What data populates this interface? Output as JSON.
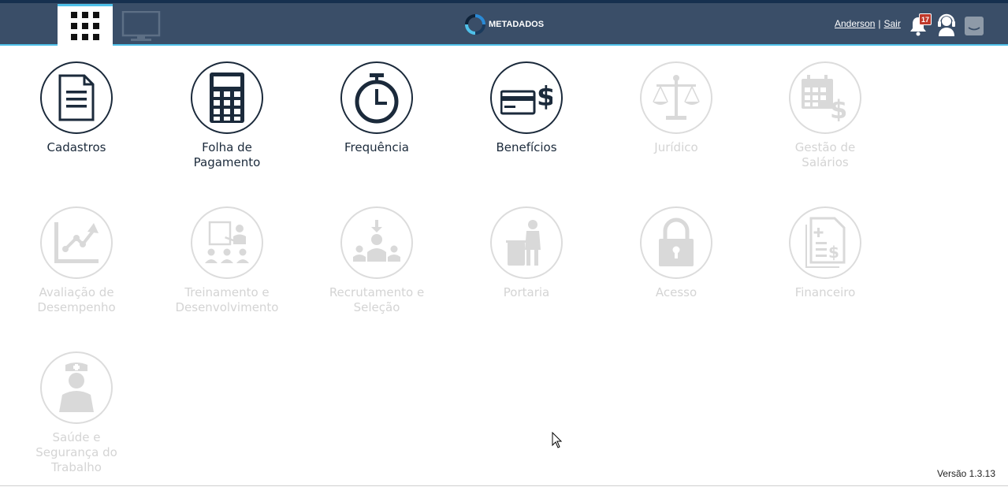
{
  "header": {
    "logo_text": "METADADOS",
    "user_name": "Anderson",
    "separator": "|",
    "logout_label": "Sair",
    "notification_count": "17",
    "colors": {
      "bar": "#3a4e68",
      "accent": "#4fc1ea",
      "badge": "#c0392b"
    }
  },
  "modules": [
    {
      "id": "cadastros",
      "label": "Cadastros",
      "state": "active",
      "icon": "document-icon"
    },
    {
      "id": "folha",
      "label": "Folha de\nPagamento",
      "state": "active",
      "icon": "calculator-icon"
    },
    {
      "id": "frequencia",
      "label": "Frequência",
      "state": "active",
      "icon": "stopwatch-icon"
    },
    {
      "id": "beneficios",
      "label": "Benefícios",
      "state": "active",
      "icon": "card-dollar-icon"
    },
    {
      "id": "juridico",
      "label": "Jurídico",
      "state": "disabled",
      "icon": "scales-icon"
    },
    {
      "id": "gestao",
      "label": "Gestão de\nSalários",
      "state": "disabled",
      "icon": "calendar-dollar-icon"
    },
    {
      "id": "avaliacao",
      "label": "Avaliação de\nDesempenho",
      "state": "disabled",
      "icon": "chart-up-icon"
    },
    {
      "id": "treinamento",
      "label": "Treinamento e\nDesenvolvimento",
      "state": "disabled",
      "icon": "presentation-icon"
    },
    {
      "id": "recrutamento",
      "label": "Recrutamento e\nSeleção",
      "state": "disabled",
      "icon": "recruitment-icon"
    },
    {
      "id": "portaria",
      "label": "Portaria",
      "state": "disabled",
      "icon": "reception-icon"
    },
    {
      "id": "acesso",
      "label": "Acesso",
      "state": "disabled",
      "icon": "padlock-icon"
    },
    {
      "id": "financeiro",
      "label": "Financeiro",
      "state": "disabled",
      "icon": "financial-doc-icon"
    },
    {
      "id": "saude",
      "label": "Saúde e\nSegurança do\nTrabalho",
      "state": "disabled",
      "icon": "nurse-icon"
    }
  ],
  "footer": {
    "version": "Versão 1.3.13"
  }
}
